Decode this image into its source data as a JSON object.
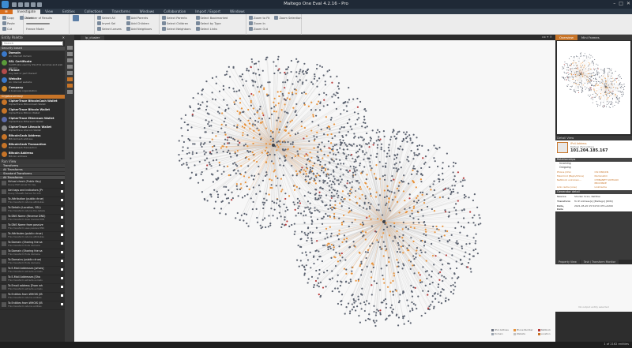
{
  "window": {
    "title": "Maltego One Eval 4.2.16 - Pro"
  },
  "menu_tabs": [
    "Investigate",
    "View",
    "Entities",
    "Collections",
    "Transforms",
    "Windows",
    "Collaboration",
    "Import / Export",
    "Windows"
  ],
  "ribbon": {
    "clipboard": [
      "Copy",
      "Paste",
      "Cut",
      "Delete"
    ],
    "find": [
      "Number of Results",
      "Freeze Mode"
    ],
    "select": [
      "Invert Sel",
      "Select All",
      "Select Leaves",
      "Select Bookmarked"
    ],
    "select2": [
      "Select Parents",
      "Select Children",
      "Select Neighbors",
      "Select by Type",
      "Select Links"
    ],
    "select3": [
      "Add Parents",
      "Add Children",
      "Add Neighbors",
      "Select Links",
      "Select Leaves"
    ],
    "zoom": [
      "Zoom to Fit",
      "Zoom In",
      "Zoom Out",
      "Zoom Selection"
    ]
  },
  "palette": {
    "title": "Entity Palette",
    "search_placeholder": "Search",
    "category_identity": "Security based",
    "category_crypto": "Cryptocurrency",
    "items": [
      {
        "t1": "Domain",
        "t2": "An internet domain",
        "color": "#3a78c9"
      },
      {
        "t1": "SSL Certificate",
        "t2": "Certificate used by SSL/TLS services and web servers",
        "color": "#5a9a3a"
      },
      {
        "t1": "Phrase",
        "t2": "Any text or part thereof",
        "color": "#b24b4b"
      },
      {
        "t1": "Website",
        "t2": "An internet website",
        "color": "#3a78c9"
      },
      {
        "t1": "Company",
        "t2": "A business organization",
        "color": "#d08a2a"
      }
    ],
    "crypto_items": [
      {
        "t1": "CipherTrace BitcoinCash Wallet",
        "t2": "CipherTrace BitcoinCash Wallet",
        "color": "#c77428"
      },
      {
        "t1": "CipherTrace Bitcoin Wallet",
        "t2": "CipherTrace Bitcoin Wallet",
        "color": "#c77428"
      },
      {
        "t1": "CipherTrace Ethereum Wallet",
        "t2": "CipherTrace Ethereum Wallet",
        "color": "#5b6aa8"
      },
      {
        "t1": "CipherTrace Litecoin Wallet",
        "t2": "CipherTrace Litecoin Wallet",
        "color": "#8a8a8a"
      },
      {
        "t1": "BitcoinCash Address",
        "t2": "BitcoinCash address",
        "color": "#c77428"
      },
      {
        "t1": "BitcoinCash Transaction",
        "t2": "BitcoinCash Transaction",
        "color": "#c77428"
      },
      {
        "t1": "Bitcoin Address",
        "t2": "Bitcoin address",
        "color": "#c77428"
      }
    ]
  },
  "run_view": {
    "title": "Run View",
    "categories": [
      "Transforms",
      "All Transforms",
      "Standard Transforms",
      "All Transforms"
    ],
    "transforms": [
      {
        "t1": "Virtual check (Public Key)",
        "t2": "Query PGP server for key"
      },
      {
        "t1": "Get tags and indicators [Pr",
        "t2": "Query VTuseEx Server for info"
      },
      {
        "t1": "To Attribution (public=true)",
        "t2": "This transform returns attributes"
      },
      {
        "t1": "To Details (Location, SSL)",
        "t2": "This transform returns the details"
      },
      {
        "t1": "To DNS Name (Reverse DNS)",
        "t2": "This transform does reverse DNS"
      },
      {
        "t1": "To DNS Name from passive",
        "t2": "This transform uses passive DNS"
      },
      {
        "t1": "To Attributes (public=true)",
        "t2": "This transform returns attributes"
      },
      {
        "t1": "To Domain (Sharing the sa",
        "t2": "This transform finds domains"
      },
      {
        "t1": "To Domain (Sharing the sa",
        "t2": "This transform finds domains"
      },
      {
        "t1": "To Domains (public=true)",
        "t2": "This transform finds domains"
      },
      {
        "t1": "To E-Mail Addresses [whois]",
        "t2": "This transform extracts e-mails"
      },
      {
        "t1": "To E-Mail Addresses [Sha",
        "t2": "This transform extracts e-mails"
      },
      {
        "t1": "To Email address [From wh",
        "t2": "This transform extracts e-mails"
      },
      {
        "t1": "To Entities from WHOIS (IB",
        "t2": "This transform returns entities"
      },
      {
        "t1": "To Entities from WHOIS (IB",
        "t2": "This transform returns entities"
      }
    ]
  },
  "graph": {
    "tab": "ip_cluster"
  },
  "legend": [
    "IPv4 Address",
    "Phone Number",
    "Netblock",
    "Domain",
    "Website",
    "Location"
  ],
  "legend_colors": [
    "#6b7280",
    "#e8923a",
    "#b93a3a",
    "#9aa3ad",
    "#c2c2c2",
    "#c77428"
  ],
  "right": {
    "tabs": [
      "Overview",
      "Mini Frames"
    ],
    "detail_title": "Detail View",
    "entity_type": "IPv4 Address",
    "entity_sub": "Maltego IPv4 Address",
    "entity_value": "101.204.185.167",
    "section_relationships": "Relationships",
    "incoming": "Incoming",
    "outgoing": "Outgoing",
    "links": [
      "Phone (Chin",
      "CSI DNS/CN",
      "Maxmind (Bejin/China)",
      "Nominatim",
      "Netblock unknown...",
      "CHINANET SICHUAN PROVINCE",
      "Link cache (one)",
      "LinkCache"
    ],
    "section_generator": "Generator detail",
    "props": [
      {
        "k": "Source",
        "v": "Shodan Scan, Netflow"
      },
      {
        "k": "Transform",
        "v": "To IP Address[s] [Maltego] [DNS]"
      },
      {
        "k": "Date, Date",
        "v": "2021-05-20 15:54:50 UTC+0200"
      }
    ],
    "ptabs": [
      "Property View",
      "Task / Transform Monitor"
    ],
    "pview_msg": "No output entity selected"
  },
  "status": {
    "right": "1 of 2162 entities"
  }
}
